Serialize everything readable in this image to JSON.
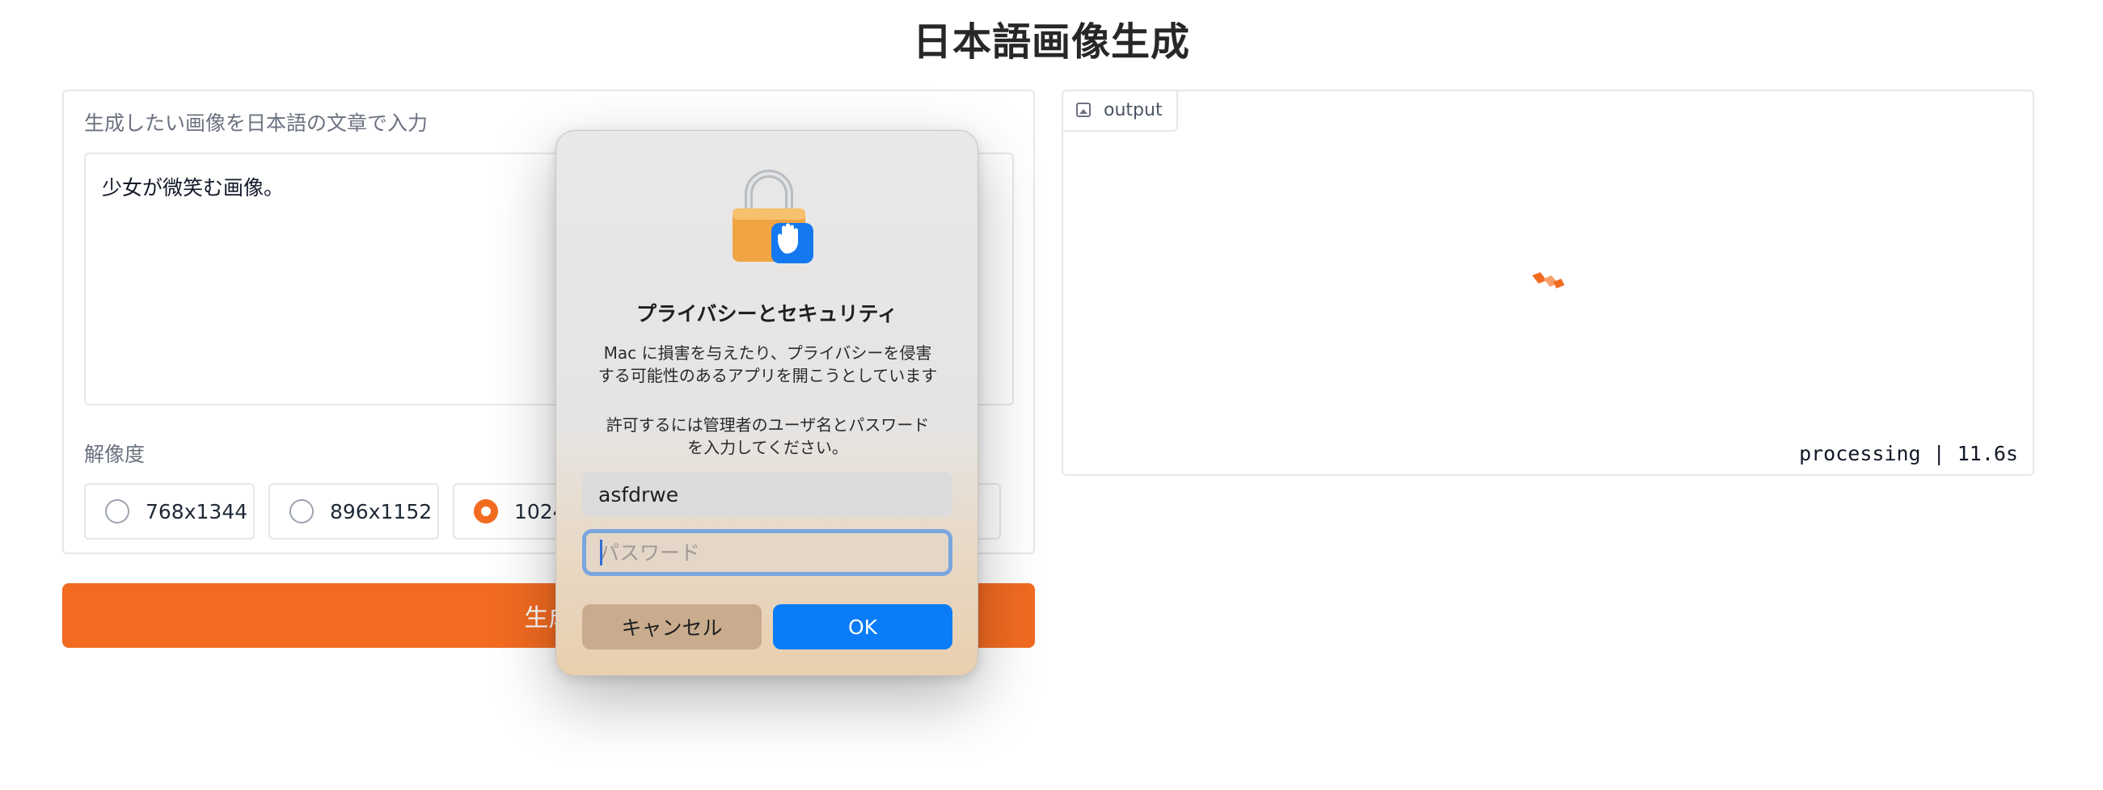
{
  "page": {
    "title": "日本語画像生成"
  },
  "left": {
    "prompt_label": "生成したい画像を日本語の文章で入力",
    "prompt_value": "少女が微笑む画像。",
    "resolution_label": "解像度",
    "resolutions": [
      {
        "label": "768x1344",
        "selected": false
      },
      {
        "label": "896x1152",
        "selected": false
      },
      {
        "label": "1024x1024",
        "selected": true
      }
    ],
    "generate_label": "生成"
  },
  "right": {
    "output_tab": "output",
    "status": "processing | 11.6s"
  },
  "dialog": {
    "title": "プライバシーとセキュリティ",
    "message_line1": "Mac に損害を与えたり、プライバシーを侵害",
    "message_line2": "する可能性のあるアプリを開こうとしています",
    "message_line3": "許可するには管理者のユーザ名とパスワード",
    "message_line4": "を入力してください。",
    "username": "asfdrwe",
    "password_placeholder": "パスワード",
    "cancel_label": "キャンセル",
    "ok_label": "OK"
  },
  "colors": {
    "accent": "#f26b21",
    "ok_blue": "#0a7cf7"
  }
}
